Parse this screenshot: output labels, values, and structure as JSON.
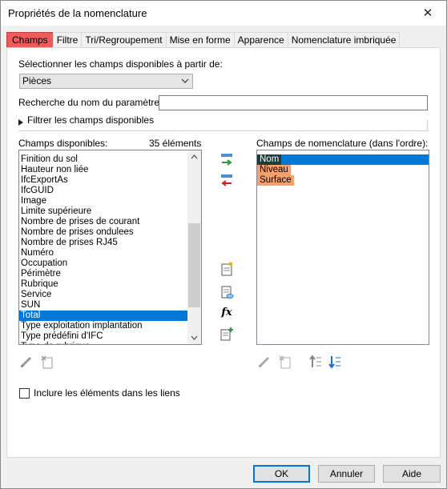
{
  "window": {
    "title": "Propriétés de la nomenclature",
    "close_glyph": "✕"
  },
  "tabs": [
    {
      "label": "Champs",
      "active": true
    },
    {
      "label": "Filtre"
    },
    {
      "label": "Tri/Regroupement"
    },
    {
      "label": "Mise en forme"
    },
    {
      "label": "Apparence"
    },
    {
      "label": "Nomenclature imbriquée"
    }
  ],
  "source": {
    "label": "Sélectionner les champs disponibles à partir de:",
    "selected": "Pièces"
  },
  "search": {
    "label": "Recherche du nom du paramètre:",
    "value": ""
  },
  "filter": {
    "label": "Filtrer les champs disponibles"
  },
  "available": {
    "label": "Champs disponibles:",
    "count": "35 éléments",
    "items": [
      "Finition du sol",
      "Hauteur non liée",
      "IfcExportAs",
      "IfcGUID",
      "Image",
      "Limite supérieure",
      "Nombre de prises de courant",
      "Nombre de prises ondulees",
      "Nombre de prises RJ45",
      "Numéro",
      "Occupation",
      "Périmètre",
      "Rubrique",
      "Service",
      "SUN",
      "Total",
      "Type exploitation implantation",
      "Type prédéfini d'IFC",
      "Type de rubrique"
    ],
    "selected_index": 15,
    "scroll_position": 0.72
  },
  "schedule": {
    "label": "Champs de nomenclature (dans l'ordre):",
    "items": [
      "Nom",
      "Niveau",
      "Surface"
    ],
    "selected_index": 0
  },
  "checkbox": {
    "label": "Inclure les éléments dans les liens",
    "checked": false
  },
  "buttons": {
    "ok": "OK",
    "cancel": "Annuler",
    "help": "Aide"
  },
  "icons": {
    "add": "add-field-icon",
    "remove": "remove-field-icon",
    "new_parameter": "new-parameter-icon",
    "shared": "shared-parameter-icon",
    "formula": "formula-icon",
    "combine": "combine-parameters-icon",
    "edit": "edit-pencil-icon",
    "delete": "delete-parameter-icon",
    "move_up": "move-up-icon",
    "move_down": "move-down-icon",
    "formula_glyph": "fx"
  },
  "colors": {
    "selection": "#0078d7",
    "active_tab": "#f05a5a",
    "highlight": "#f7a06a"
  }
}
